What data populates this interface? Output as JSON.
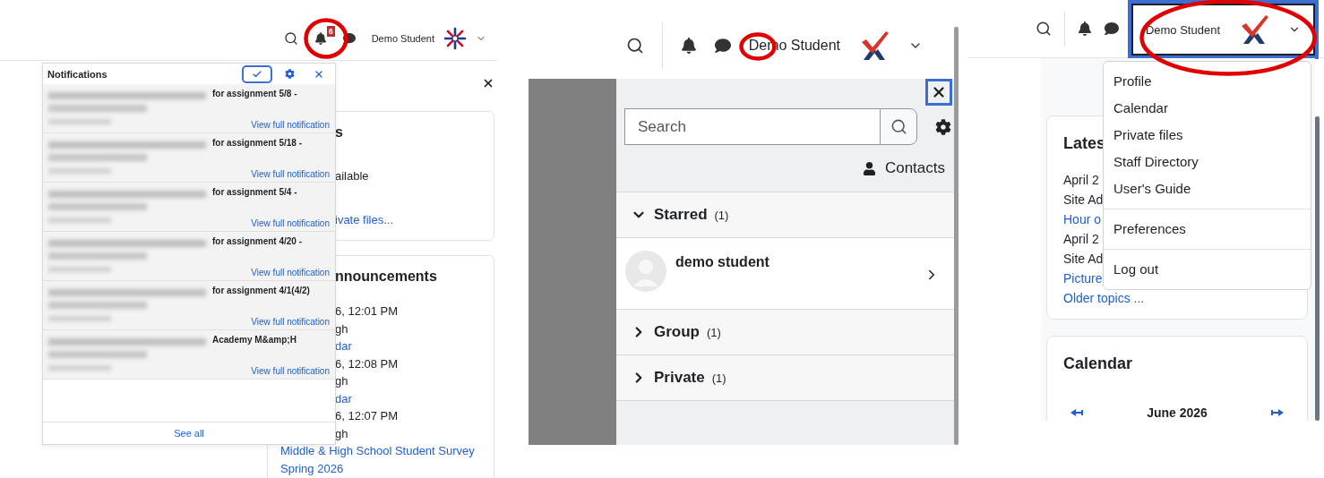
{
  "screens": [
    {
      "kind": "notifications",
      "header": {
        "user_name": "Demo Student",
        "logo": {
          "kind": "star"
        },
        "badge": "6",
        "menu_open": false
      },
      "popover": {
        "title": "Notifications",
        "items": [
          {
            "text": "for assignment 5/8 -",
            "link": "View full notification"
          },
          {
            "text": "for assignment 5/18 -",
            "link": "View full notification"
          },
          {
            "text": "for assignment 5/4 -",
            "link": "View full notification"
          },
          {
            "text": "for assignment 4/20 -",
            "link": "View full notification"
          },
          {
            "text": "for assignment 4/1(4/2)",
            "link": "View full notification"
          },
          {
            "text": "Academy M&amp;H",
            "link": "View full notification"
          }
        ],
        "footer": "See all"
      },
      "cards": [
        {
          "title": {
            "text": "s",
            "cut": true
          },
          "lines": [
            {
              "kind": "text",
              "text": "ailable",
              "cut": true
            },
            {
              "kind": "link",
              "text": "ivate files...",
              "cut": true
            }
          ]
        },
        {
          "title": {
            "text": "nnouncements",
            "cut": true
          },
          "lines": [
            {
              "kind": "text",
              "text": "6, 12:01 PM",
              "cut": true
            },
            {
              "kind": "text",
              "text": "gh",
              "cut": true
            },
            {
              "kind": "link",
              "text": "dar",
              "cut": true
            },
            {
              "kind": "text",
              "text": "6, 12:08 PM",
              "cut": true
            },
            {
              "kind": "text",
              "text": "gh",
              "cut": true
            },
            {
              "kind": "link",
              "text": "dar",
              "cut": true
            },
            {
              "kind": "text",
              "text": "6, 12:07 PM",
              "cut": true
            },
            {
              "kind": "text",
              "text": "gh",
              "cut": true
            },
            {
              "kind": "link",
              "text": "Middle & High School Student Survey"
            },
            {
              "kind": "link",
              "text": "Spring 2026"
            }
          ]
        }
      ]
    },
    {
      "kind": "messages",
      "header": {
        "user_name": "Demo Student",
        "logo": {
          "kind": "check"
        },
        "menu_open": false
      },
      "drawer": {
        "search": {
          "placeholder": "Search"
        },
        "contacts": "Contacts",
        "sections": [
          {
            "label": "Starred",
            "count": "(1)",
            "expanded": true,
            "contacts": [
              {
                "name": "demo student"
              }
            ]
          },
          {
            "label": "Group",
            "count": "(1)",
            "expanded": false
          },
          {
            "label": "Private",
            "count": "(1)",
            "expanded": false
          }
        ]
      }
    },
    {
      "kind": "user_menu",
      "header": {
        "user_name": "Demo Student",
        "logo": {
          "kind": "check"
        },
        "menu_open": true
      },
      "menu": {
        "groups": [
          [
            "Profile",
            "Calendar",
            "Private files",
            "Staff Directory",
            "User's Guide"
          ],
          [
            "Preferences"
          ],
          [
            "Log out"
          ]
        ]
      },
      "cards": [
        {
          "title": {
            "text": "Lates"
          },
          "lines": [
            {
              "kind": "text",
              "text": "April 2"
            },
            {
              "kind": "text",
              "text": "Site Ad"
            },
            {
              "kind": "link",
              "text": "Hour o"
            },
            {
              "kind": "text",
              "text": "April 2"
            },
            {
              "kind": "text",
              "text": "Site Ad"
            },
            {
              "kind": "link",
              "text": "Picture"
            },
            {
              "kind": "link",
              "text": "Older topics ..."
            }
          ]
        },
        {
          "title": {
            "text": "Calendar"
          },
          "month": "June 2026"
        }
      ]
    }
  ]
}
